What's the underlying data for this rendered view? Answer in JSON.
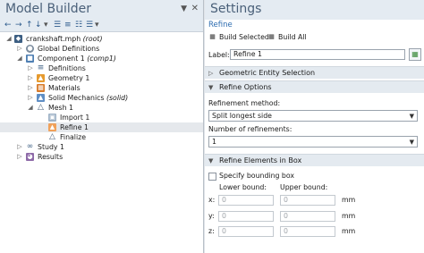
{
  "model_builder": {
    "title": "Model Builder",
    "tree": [
      {
        "label": "crankshaft.mph",
        "italic": "(root)"
      },
      {
        "label": "Global Definitions",
        "italic": ""
      },
      {
        "label": "Component 1",
        "italic": "(comp1)"
      },
      {
        "label": "Definitions",
        "italic": ""
      },
      {
        "label": "Geometry 1",
        "italic": ""
      },
      {
        "label": "Materials",
        "italic": ""
      },
      {
        "label": "Solid Mechanics",
        "italic": "(solid)"
      },
      {
        "label": "Mesh 1",
        "italic": ""
      },
      {
        "label": "Import 1",
        "italic": ""
      },
      {
        "label": "Refine 1",
        "italic": ""
      },
      {
        "label": "Finalize",
        "italic": ""
      },
      {
        "label": "Study 1",
        "italic": ""
      },
      {
        "label": "Results",
        "italic": ""
      }
    ]
  },
  "settings": {
    "title": "Settings",
    "subtitle": "Refine",
    "build_selected": "Build Selected",
    "build_all": "Build All",
    "label_caption": "Label:",
    "label_value": "Refine 1",
    "sections": {
      "geometric": "Geometric Entity Selection",
      "refine_options": "Refine Options",
      "refine_box": "Refine Elements in Box"
    },
    "refinement_method_label": "Refinement method:",
    "refinement_method_value": "Split longest side",
    "num_refinements_label": "Number of refinements:",
    "num_refinements_value": "1",
    "specify_bbox": "Specify bounding box",
    "lower_bound": "Lower bound:",
    "upper_bound": "Upper bound:",
    "coords": [
      {
        "axis": "x:",
        "lower": "0",
        "upper": "0",
        "unit": "mm"
      },
      {
        "axis": "y:",
        "lower": "0",
        "upper": "0",
        "unit": "mm"
      },
      {
        "axis": "z:",
        "lower": "0",
        "upper": "0",
        "unit": "mm"
      }
    ]
  }
}
